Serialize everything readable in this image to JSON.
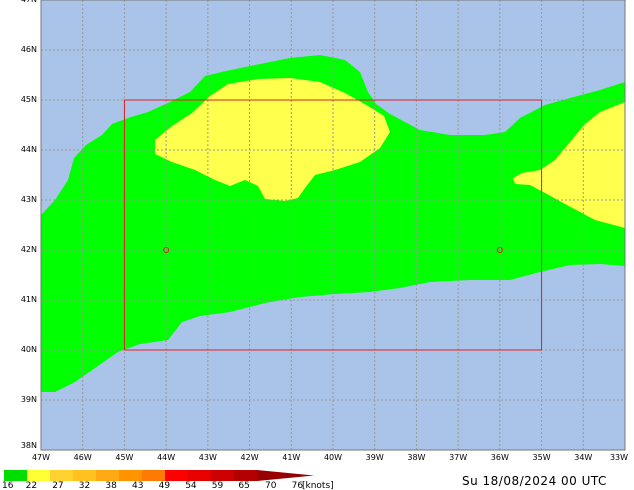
{
  "map": {
    "lat_labels": [
      "47N",
      "46N",
      "45N",
      "44N",
      "43N",
      "42N",
      "41N",
      "40N",
      "39N",
      "38N"
    ],
    "lon_labels": [
      "47W",
      "46W",
      "45W",
      "44W",
      "43W",
      "42W",
      "41W",
      "40W",
      "39W",
      "38W",
      "37W",
      "36W",
      "35W",
      "34W",
      "33W"
    ],
    "extent": {
      "lon_min": -47,
      "lon_max": -33,
      "lat_min": 38,
      "lat_max": 47
    },
    "region_box": {
      "lon_min": -45,
      "lon_max": -35,
      "lat_min": 40,
      "lat_max": 45
    },
    "markers": [
      {
        "name": "point-west",
        "lon": -44,
        "lat": 42
      },
      {
        "name": "point-east",
        "lon": -36,
        "lat": 42
      }
    ],
    "colors": {
      "sea": "#a9c4e8",
      "green_band": "#00ff00",
      "yellow_band": "#ffff4d",
      "grid": "#999999",
      "box": "#dd2222"
    }
  },
  "legend": {
    "values": [
      "16",
      "22",
      "27",
      "32",
      "38",
      "43",
      "49",
      "54",
      "59",
      "65",
      "70",
      "76"
    ],
    "unit": "[knots]",
    "colors": [
      "#00dd00",
      "#ffff33",
      "#ffd232",
      "#ffc21e",
      "#ffaa14",
      "#ff9400",
      "#ff7a00",
      "#ff0000",
      "#e60000",
      "#cc0000",
      "#b30000",
      "#990000"
    ]
  },
  "timestamp": "Su 18/08/2024 00 UTC"
}
